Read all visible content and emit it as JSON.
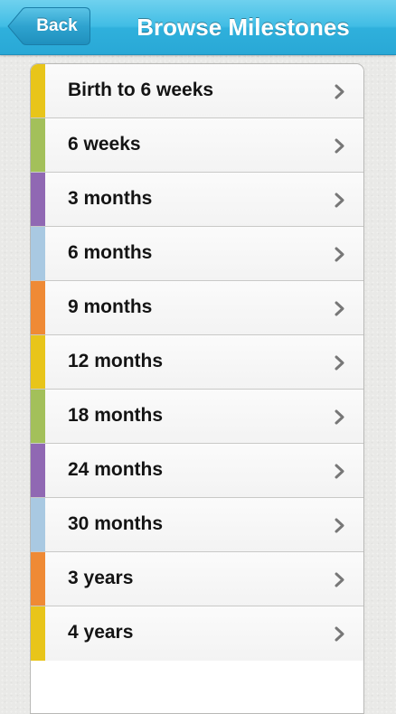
{
  "nav": {
    "back_label": "Back",
    "title": "Browse Milestones",
    "bar_color": "#3ab8e2"
  },
  "milestones": [
    {
      "label": "Birth to 6 weeks",
      "color": "#e8c51a",
      "icon": "chevron-right-icon"
    },
    {
      "label": "6 weeks",
      "color": "#a3c05a",
      "icon": "chevron-right-icon"
    },
    {
      "label": "3 months",
      "color": "#9068b3",
      "icon": "chevron-right-icon"
    },
    {
      "label": "6 months",
      "color": "#a9c9e2",
      "icon": "chevron-right-icon"
    },
    {
      "label": "9 months",
      "color": "#ef8a35",
      "icon": "chevron-right-icon"
    },
    {
      "label": "12 months",
      "color": "#e8c51a",
      "icon": "chevron-right-icon"
    },
    {
      "label": "18 months",
      "color": "#a3c05a",
      "icon": "chevron-right-icon"
    },
    {
      "label": "24 months",
      "color": "#9068b3",
      "icon": "chevron-right-icon"
    },
    {
      "label": "30 months",
      "color": "#a9c9e2",
      "icon": "chevron-right-icon"
    },
    {
      "label": "3 years",
      "color": "#ef8a35",
      "icon": "chevron-right-icon"
    },
    {
      "label": "4 years",
      "color": "#e8c51a",
      "icon": "chevron-right-icon"
    }
  ]
}
